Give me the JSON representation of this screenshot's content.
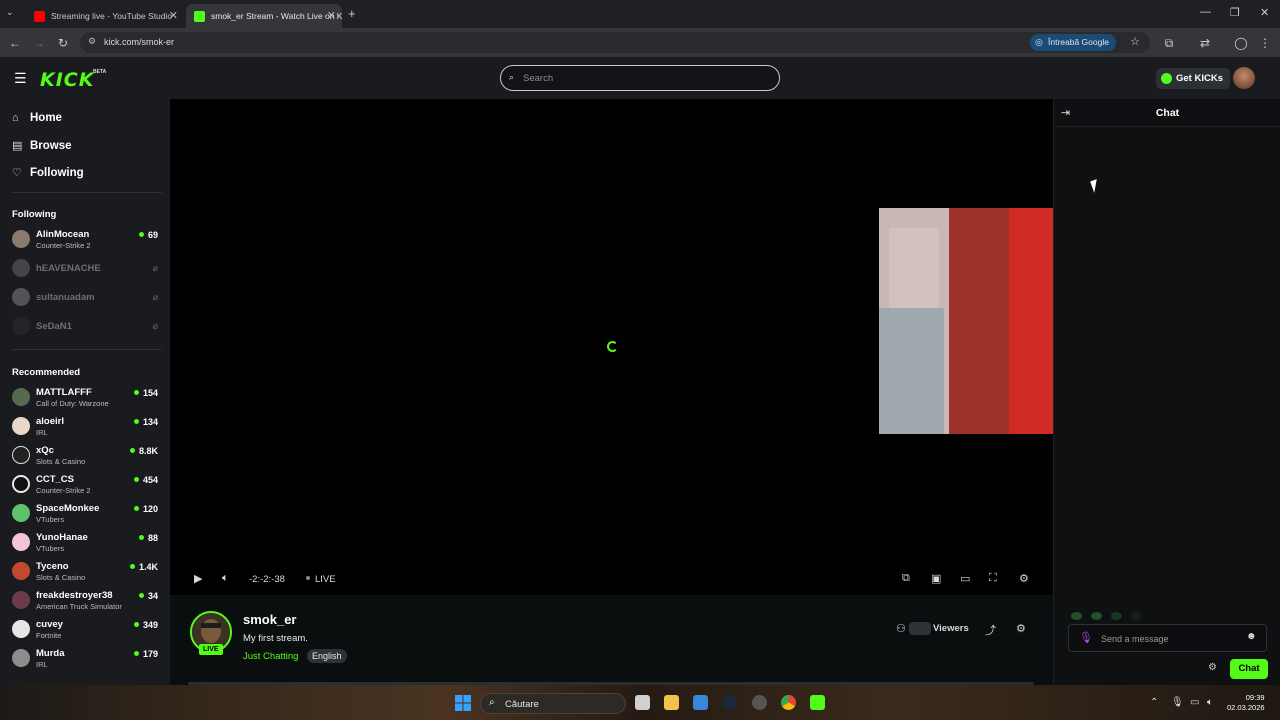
{
  "browser": {
    "tabs": [
      {
        "title": "Streaming live - YouTube Studio",
        "favicon_color": "#ff0000"
      },
      {
        "title": "smok_er Stream - Watch Live on Kick",
        "favicon_color": "#53fc18"
      }
    ],
    "new_tab_icon": "plus-icon",
    "url": "kick.com/smok-er",
    "ask_google": "Întreabă Google"
  },
  "kick": {
    "logo": "KICK",
    "beta": "BETA",
    "search_placeholder": "Search",
    "get_kicks": "Get KICKs",
    "accent": "#53fc18"
  },
  "sidebar": {
    "nav": [
      {
        "label": "Home",
        "icon": "home-icon"
      },
      {
        "label": "Browse",
        "icon": "browse-icon"
      },
      {
        "label": "Following",
        "icon": "heart-icon"
      }
    ],
    "following_title": "Following",
    "following": [
      {
        "name": "AlinMocean",
        "category": "Counter-Strike 2",
        "viewers": "69",
        "online": true
      },
      {
        "name": "hEAVENACHE",
        "online": false
      },
      {
        "name": "sultanuadam",
        "online": false
      },
      {
        "name": "SeDaN1",
        "online": false
      }
    ],
    "recommended_title": "Recommended",
    "recommended": [
      {
        "name": "MATTLAFFF",
        "category": "Call of Duty: Warzone",
        "viewers": "154"
      },
      {
        "name": "aloeirl",
        "category": "IRL",
        "viewers": "134"
      },
      {
        "name": "xQc",
        "category": "Slots & Casino",
        "viewers": "8.8K"
      },
      {
        "name": "CCT_CS",
        "category": "Counter-Strike 2",
        "viewers": "454"
      },
      {
        "name": "SpaceMonkee",
        "category": "VTubers",
        "viewers": "120"
      },
      {
        "name": "YunoHanae",
        "category": "VTubers",
        "viewers": "88"
      },
      {
        "name": "Tyceno",
        "category": "Slots & Casino",
        "viewers": "1.4K"
      },
      {
        "name": "freakdestroyer38",
        "category": "American Truck Simulator",
        "viewers": "34"
      },
      {
        "name": "cuvey",
        "category": "Fortnite",
        "viewers": "349"
      },
      {
        "name": "Murda",
        "category": "IRL",
        "viewers": "179"
      }
    ]
  },
  "player": {
    "timecode": "-2:-2:-38",
    "live_label": "LIVE"
  },
  "stream": {
    "name": "smok_er",
    "title": "My first stream.",
    "category": "Just Chatting",
    "language": "English",
    "live_badge": "LIVE",
    "viewers_label": "Viewers"
  },
  "chat": {
    "title": "Chat",
    "placeholder": "Send a message",
    "send_button": "Chat"
  },
  "taskbar": {
    "search": "Căutare",
    "time": "09:39",
    "date": "02.03.2026"
  }
}
